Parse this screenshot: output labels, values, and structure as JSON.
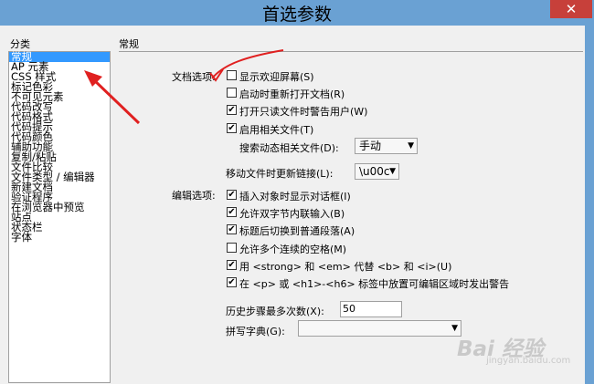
{
  "window": {
    "title": "首选参数",
    "close_glyph": "✕"
  },
  "sidebar": {
    "label": "分类",
    "items": [
      {
        "label": "常规",
        "selected": true
      },
      {
        "label": "AP 元素"
      },
      {
        "label": "CSS 样式"
      },
      {
        "label": "标记色彩"
      },
      {
        "label": "不可见元素"
      },
      {
        "label": "代码改写"
      },
      {
        "label": "代码格式"
      },
      {
        "label": "代码提示"
      },
      {
        "label": "代码颜色"
      },
      {
        "label": "辅助功能"
      },
      {
        "label": "复制/粘贴"
      },
      {
        "label": "文件比较"
      },
      {
        "label": "文件类型 / 编辑器"
      },
      {
        "label": "新建文档"
      },
      {
        "label": "验证程序"
      },
      {
        "label": "在浏览器中预览"
      },
      {
        "label": "站点"
      },
      {
        "label": "状态栏"
      },
      {
        "label": "字体"
      }
    ]
  },
  "main": {
    "section_title": "常规",
    "document_options": {
      "label": "文档选项:",
      "show_welcome": {
        "label": "显示欢迎屏幕(S)",
        "checked": false
      },
      "reopen_docs": {
        "label": "启动时重新打开文档(R)",
        "checked": false
      },
      "warn_readonly": {
        "label": "打开只读文件时警告用户(W)",
        "checked": true
      },
      "enable_related": {
        "label": "启用相关文件(T)",
        "checked": true
      },
      "search_dynamic": {
        "label": "搜索动态相关文件(D):",
        "value": "手动"
      },
      "update_links": {
        "label": "移动文件时更新链接(L):",
        "value": "\\u00c"
      }
    },
    "editing_options": {
      "label": "编辑选项:",
      "items": [
        {
          "label": "插入对象时显示对话框(I)",
          "checked": true
        },
        {
          "label": "允许双字节内联输入(B)",
          "checked": true
        },
        {
          "label": "标题后切换到普通段落(A)",
          "checked": true
        },
        {
          "label": "允许多个连续的空格(M)",
          "checked": false
        },
        {
          "label": "用 <strong> 和 <em> 代替 <b> 和 <i>(U)",
          "checked": true
        },
        {
          "label": "在 <p> 或 <h1>-<h6> 标签中放置可编辑区域时发出警告",
          "checked": true
        }
      ]
    },
    "history": {
      "label": "历史步骤最多次数(X):",
      "value": "50"
    },
    "spelling": {
      "label": "拼写字典(G):",
      "value": ""
    }
  },
  "watermark": {
    "brand": "Bai 经验",
    "url": "jingyan.baidu.com"
  },
  "colors": {
    "titlebar": "#6aa1d3",
    "close": "#c7403a",
    "selection": "#3399ff",
    "annotation": "#e02020"
  }
}
